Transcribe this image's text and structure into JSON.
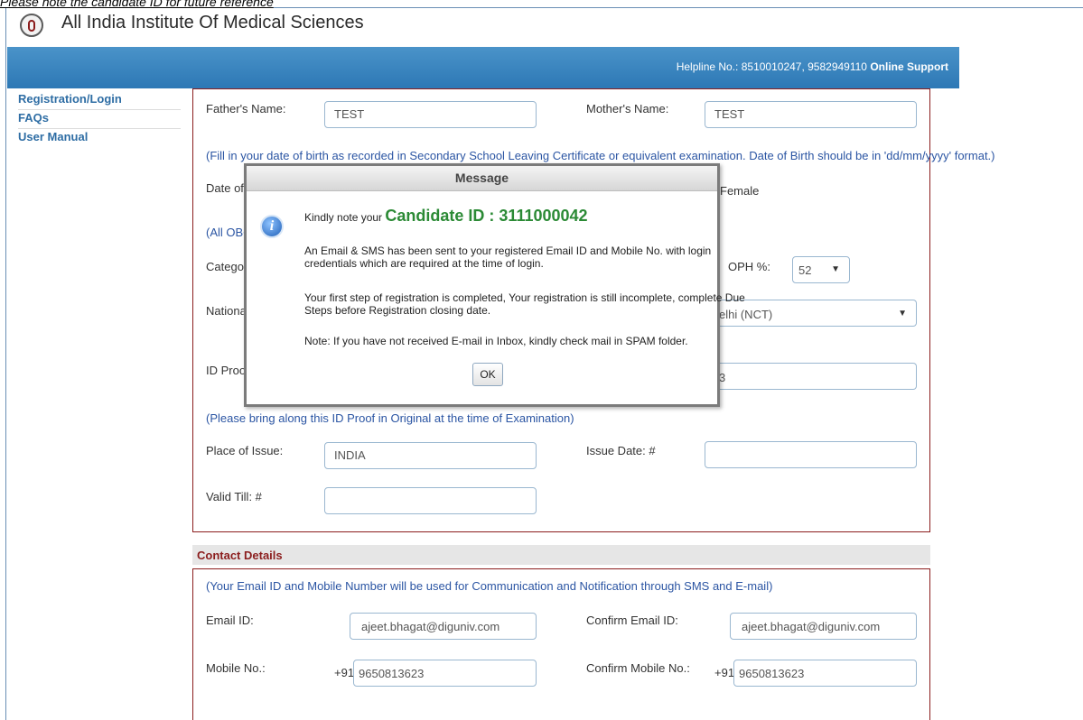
{
  "top_caption": "Please note the candidate ID for future reference",
  "header": {
    "site_title": "All India Institute Of Medical Sciences",
    "helpline_label": "Helpline No.: 8510010247, 9582949110",
    "online_support": "Online Support"
  },
  "sidebar": {
    "items": [
      {
        "label": "Registration/Login"
      },
      {
        "label": "FAQs"
      },
      {
        "label": "User Manual"
      }
    ]
  },
  "form": {
    "father_label": "Father's Name:",
    "father_value": "TEST",
    "mother_label": "Mother's Name:",
    "mother_value": "TEST",
    "dob_note": "(Fill in your date of birth as recorded in Secondary School Leaving Certificate or equivalent examination. Date of Birth should be in 'dd/mm/yyyy' format.)",
    "dob_label_partial": "Date of I",
    "gender_partial": "Female",
    "obc_note_partial": "(All OBC",
    "category_partial": "Category",
    "oph_label": "OPH %:",
    "oph_value": "52",
    "nationality_partial": "National",
    "state_value_partial": "elhi (NCT)",
    "idproof_partial": "ID Proof",
    "idnumber_partial": "3",
    "id_note": "(Please bring along this ID Proof in Original at the time of Examination)",
    "place_label": "Place of Issue:",
    "place_value": "INDIA",
    "issue_label": "Issue Date: #",
    "issue_value": "",
    "valid_label": "Valid Till: #",
    "valid_value": ""
  },
  "contact": {
    "section_title": "Contact Details",
    "note": "(Your Email ID and Mobile Number will be used for Communication and Notification through SMS and E-mail)",
    "email_label": "Email ID:",
    "email_value": "ajeet.bhagat@diguniv.com",
    "confirm_email_label": "Confirm Email ID:",
    "confirm_email_value": "ajeet.bhagat@diguniv.com",
    "mobile_label": "Mobile No.:",
    "mobile_prefix": "+91",
    "mobile_value": "9650813623",
    "confirm_mobile_label": "Confirm Mobile No.:",
    "confirm_mobile_prefix": "+91",
    "confirm_mobile_value": "9650813623"
  },
  "modal": {
    "title": "Message",
    "kindly_note": "Kindly note your",
    "candidate_id": "Candidate ID : 3111000042",
    "line1": "An Email & SMS has been sent to your registered Email ID and Mobile No. with login",
    "line1b": "credentials which are required at the time of login.",
    "line2": "Your first step of registration is completed, Your registration is still incomplete, complete Due",
    "line2b": "Steps before Registration closing date.",
    "line3": "Note: If you have not received E-mail in Inbox, kindly check mail in SPAM folder.",
    "ok_label": "OK",
    "icon_glyph": "i"
  },
  "colors": {
    "header_blue": "#2d78b5",
    "form_border": "#8b1d1d",
    "note_blue": "#2b55a3",
    "candidate_green": "#2b8a35"
  }
}
